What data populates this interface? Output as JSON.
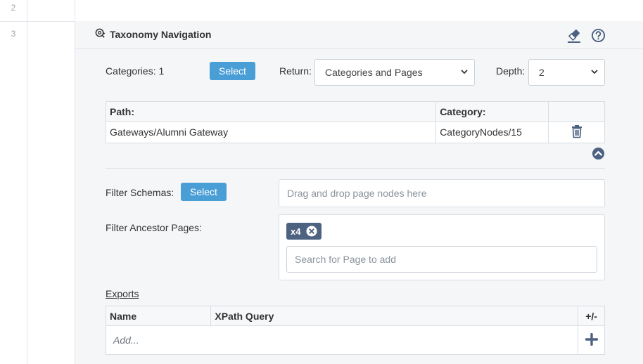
{
  "rows": {
    "prev_number": "2",
    "current_number": "3"
  },
  "module": {
    "title": "Taxonomy Navigation"
  },
  "categories": {
    "label": "Categories: 1",
    "select_label": "Select"
  },
  "return_field": {
    "label": "Return:",
    "value": "Categories and Pages"
  },
  "depth_field": {
    "label": "Depth:",
    "value": "2"
  },
  "category_table": {
    "headers": {
      "path": "Path:",
      "category": "Category:"
    },
    "rows": [
      {
        "path": "Gateways/Alumni Gateway",
        "category": "CategoryNodes/15"
      }
    ]
  },
  "filter_schemas": {
    "label": "Filter Schemas:",
    "select_label": "Select",
    "dropzone_text": "Drag and drop page nodes here"
  },
  "filter_ancestors": {
    "label": "Filter Ancestor Pages:",
    "tag": "x4",
    "search_placeholder": "Search for Page to add"
  },
  "exports": {
    "link_label": "Exports",
    "headers": {
      "name": "Name",
      "xpath": "XPath Query",
      "toggle": "+/-"
    },
    "add_placeholder": "Add..."
  },
  "colors": {
    "accent": "#4a9ed6",
    "icon": "#4d6180",
    "panel_bg": "#f4f6f8"
  }
}
